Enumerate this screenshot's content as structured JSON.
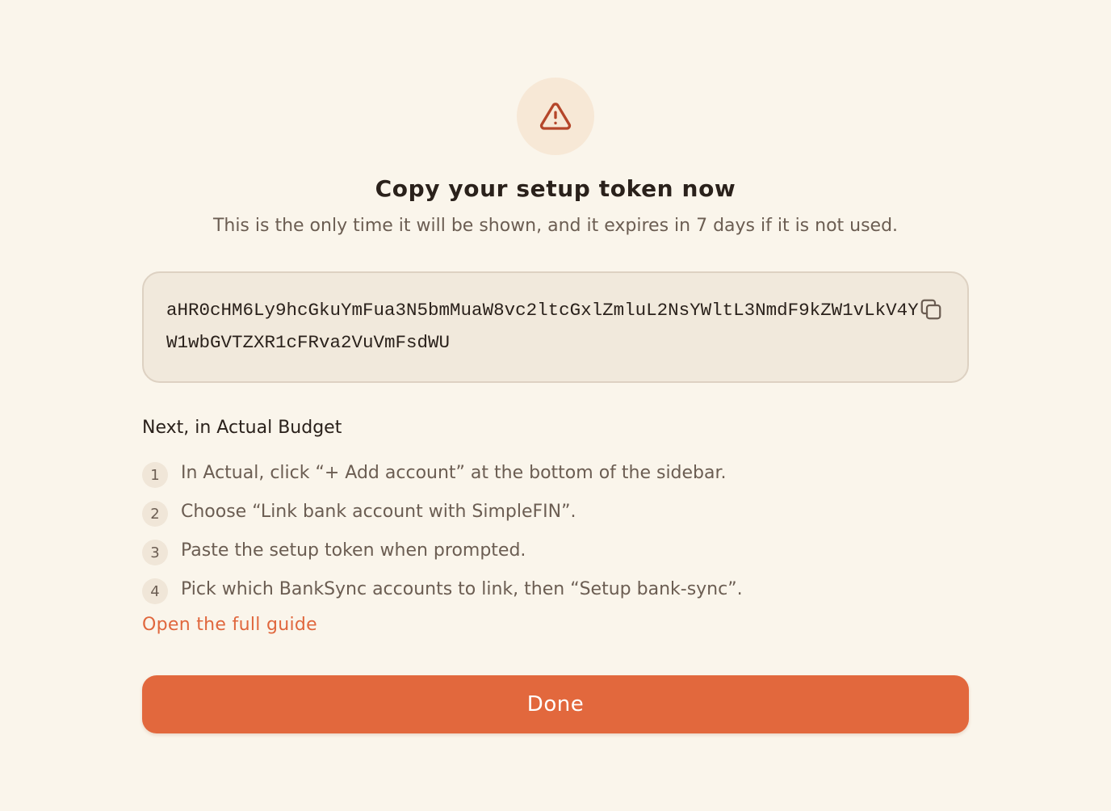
{
  "icons": {
    "warning": "warning-triangle-icon",
    "copy": "copy-icon"
  },
  "colors": {
    "background": "#faf5eb",
    "accent": "#e2683d",
    "warning_icon": "#b5462a",
    "warning_circle": "#f7e8d6",
    "token_box": "#f1e9dc"
  },
  "header": {
    "title": "Copy your setup token now",
    "subtitle": "This is the only time it will be shown, and it expires in 7 days if it is not used."
  },
  "token": {
    "value": "aHR0cHM6Ly9hcGkuYmFua3N5bmMuaW8vc2ltcGxlZmluL2NsYWltL3NmdF9kZW1vLkV4YW1wbGVTZXR1cFRva2VuVmFsdWU"
  },
  "instructions": {
    "heading": "Next, in Actual Budget",
    "steps": [
      {
        "number": "1",
        "text": "In Actual, click “+ Add account” at the bottom of the sidebar."
      },
      {
        "number": "2",
        "text": "Choose “Link bank account with SimpleFIN”."
      },
      {
        "number": "3",
        "text": "Paste the setup token when prompted."
      },
      {
        "number": "4",
        "text": "Pick which BankSync accounts to link, then “Setup bank-sync”."
      }
    ],
    "guide_link": "Open the full guide"
  },
  "actions": {
    "done_label": "Done"
  }
}
